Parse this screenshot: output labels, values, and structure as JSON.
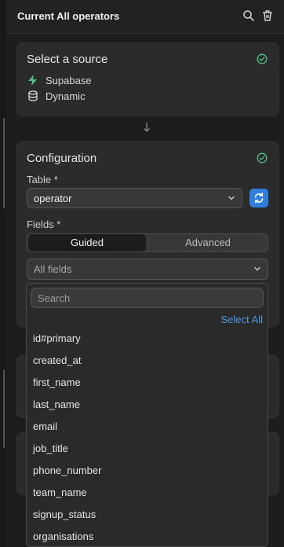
{
  "header": {
    "title": "Current All operators"
  },
  "source_card": {
    "title": "Select a source",
    "items": [
      {
        "label": "Supabase",
        "icon": "bolt-icon"
      },
      {
        "label": "Dynamic",
        "icon": "database-icon"
      }
    ]
  },
  "config_card": {
    "title": "Configuration",
    "table_label": "Table *",
    "table_value": "operator",
    "fields_label": "Fields *",
    "mode_options": [
      "Guided",
      "Advanced"
    ],
    "selected_mode": "Guided",
    "fields_value": "All fields"
  },
  "dropdown": {
    "search_placeholder": "Search",
    "select_all_label": "Select All",
    "options": [
      "id#primary",
      "created_at",
      "first_name",
      "last_name",
      "email",
      "job_title",
      "phone_number",
      "team_name",
      "signup_status",
      "organisations"
    ]
  },
  "colors": {
    "accent": "#2f7fe0",
    "success": "#4cc38a",
    "link": "#4d9be6",
    "background": "#1d1d1d",
    "card": "#2b2b2b"
  }
}
